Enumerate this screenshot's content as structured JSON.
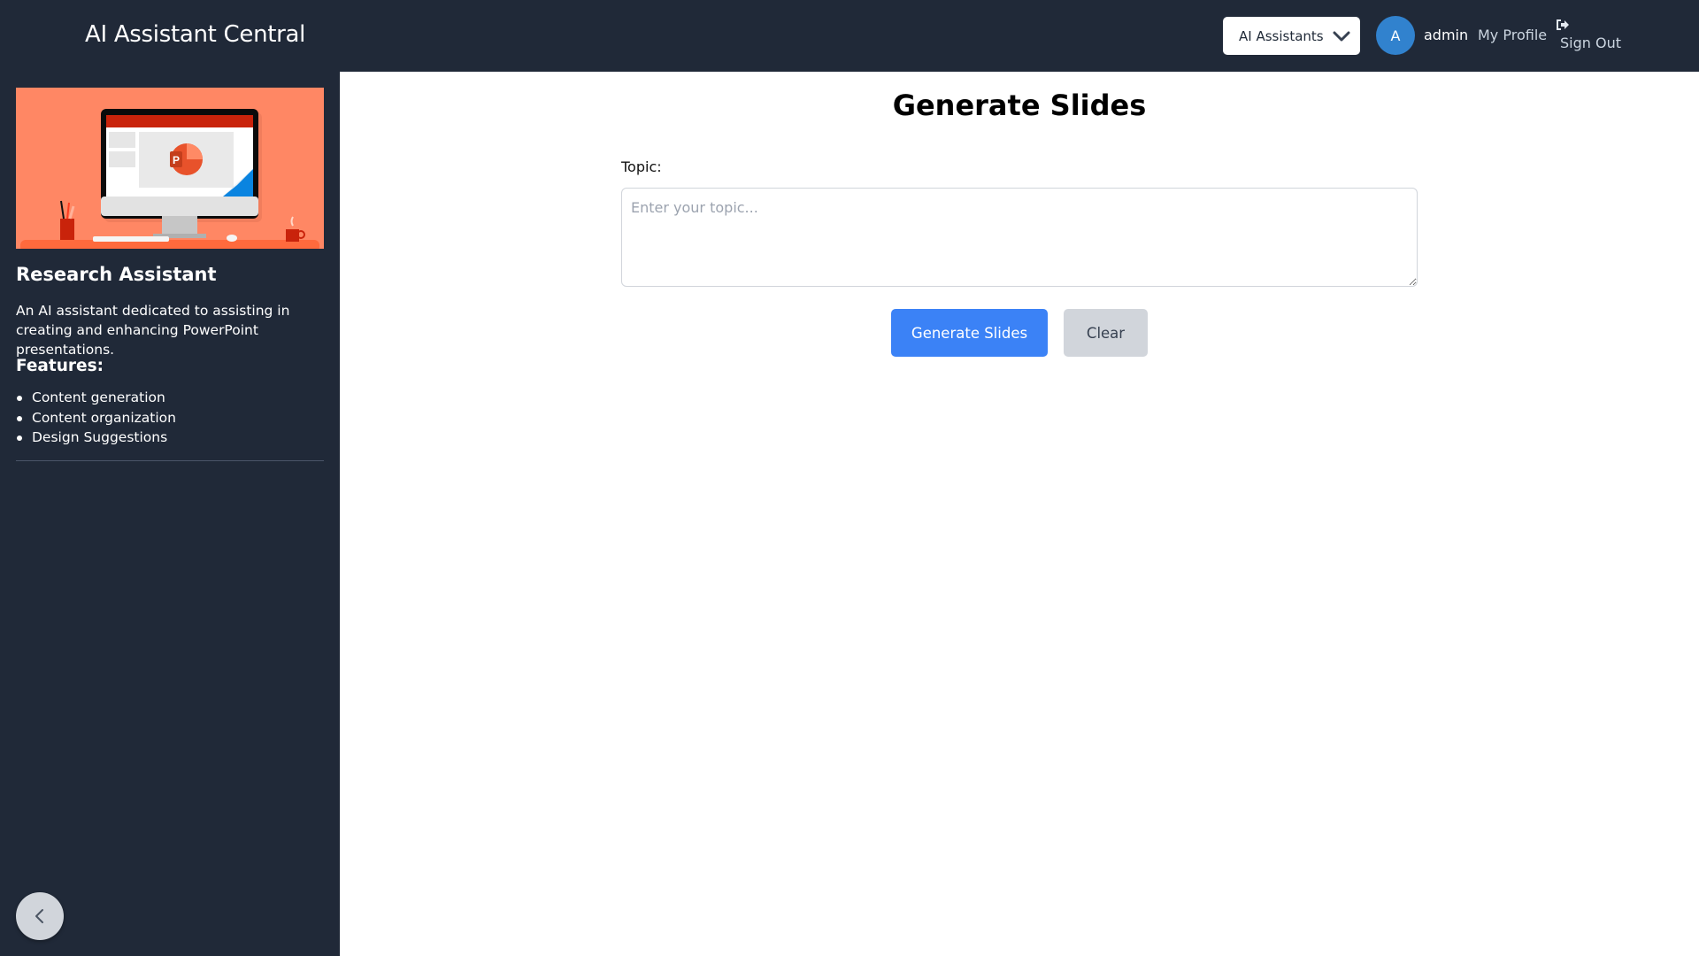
{
  "header": {
    "app_title": "AI Assistant Central",
    "dropdown_label": "AI Assistants",
    "dropdown_icon": "chevron-down-icon",
    "avatar_initial": "A",
    "username": "admin",
    "my_profile": "My Profile",
    "sign_out": "Sign Out",
    "sign_out_icon": "sign-out-icon"
  },
  "sidebar": {
    "hero_image": "powerpoint-desk-illustration",
    "assistant_name": "Research Assistant",
    "description": "An AI assistant dedicated to assisting in creating and enhancing PowerPoint presentations.",
    "features_title": "Features:",
    "features": [
      "Content generation",
      "Content organization",
      "Design Suggestions"
    ],
    "collapse_icon": "chevron-left-icon"
  },
  "main": {
    "title": "Generate Slides",
    "topic_label": "Topic:",
    "topic_value": "",
    "topic_placeholder": "Enter your topic...",
    "generate_button": "Generate Slides",
    "clear_button": "Clear"
  },
  "colors": {
    "header_bg": "#202938",
    "accent_blue": "#3b82f6",
    "avatar_blue": "#3182ce",
    "hero_bg": "#ff8764",
    "clear_gray": "#d1d5db"
  }
}
